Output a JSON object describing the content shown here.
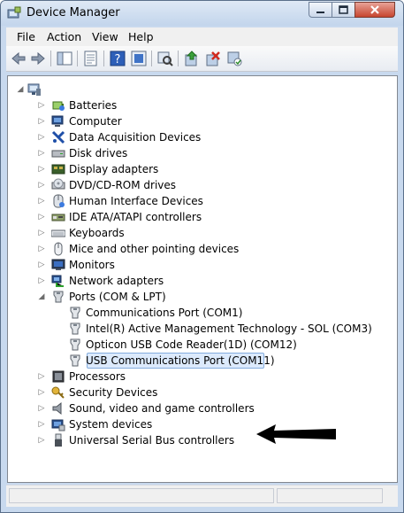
{
  "window": {
    "title": "Device Manager"
  },
  "menu": {
    "file": "File",
    "action": "Action",
    "view": "View",
    "help": "Help"
  },
  "toolbar": {
    "buttons": [
      "back-icon",
      "forward-icon",
      "show-hide-tree-icon",
      "properties-icon",
      "help-icon",
      "show-hidden-icon",
      "scan-hardware-icon",
      "update-driver-icon",
      "disable-device-icon",
      "uninstall-device-icon"
    ]
  },
  "tree": {
    "categories": [
      {
        "label": "Batteries",
        "icon": "battery-icon"
      },
      {
        "label": "Computer",
        "icon": "computer-icon"
      },
      {
        "label": "Data Acquisition Devices",
        "icon": "data-acquisition-icon"
      },
      {
        "label": "Disk drives",
        "icon": "disk-drive-icon"
      },
      {
        "label": "Display adapters",
        "icon": "display-adapter-icon"
      },
      {
        "label": "DVD/CD-ROM drives",
        "icon": "dvd-drive-icon"
      },
      {
        "label": "Human Interface Devices",
        "icon": "hid-icon"
      },
      {
        "label": "IDE ATA/ATAPI controllers",
        "icon": "ide-controller-icon"
      },
      {
        "label": "Keyboards",
        "icon": "keyboard-icon"
      },
      {
        "label": "Mice and other pointing devices",
        "icon": "mouse-icon"
      },
      {
        "label": "Monitors",
        "icon": "monitor-icon"
      },
      {
        "label": "Network adapters",
        "icon": "network-adapter-icon"
      },
      {
        "label": "Ports (COM & LPT)",
        "icon": "port-icon"
      }
    ],
    "ports": [
      {
        "label": "Communications Port (COM1)"
      },
      {
        "label": "Intel(R) Active Management Technology - SOL (COM3)"
      },
      {
        "label": "Opticon USB Code Reader(1D) (COM12)"
      },
      {
        "label": "USB Communications Port (COM11)"
      }
    ],
    "categories_after": [
      {
        "label": "Processors",
        "icon": "processor-icon"
      },
      {
        "label": "Security Devices",
        "icon": "security-key-icon"
      },
      {
        "label": "Sound, video and game controllers",
        "icon": "speaker-icon"
      },
      {
        "label": "System devices",
        "icon": "system-device-icon"
      },
      {
        "label": "Universal Serial Bus controllers",
        "icon": "usb-icon"
      }
    ]
  },
  "colors": {
    "selection": "#dceafc",
    "selection_border": "#84acdd",
    "arrow": "#000000"
  }
}
